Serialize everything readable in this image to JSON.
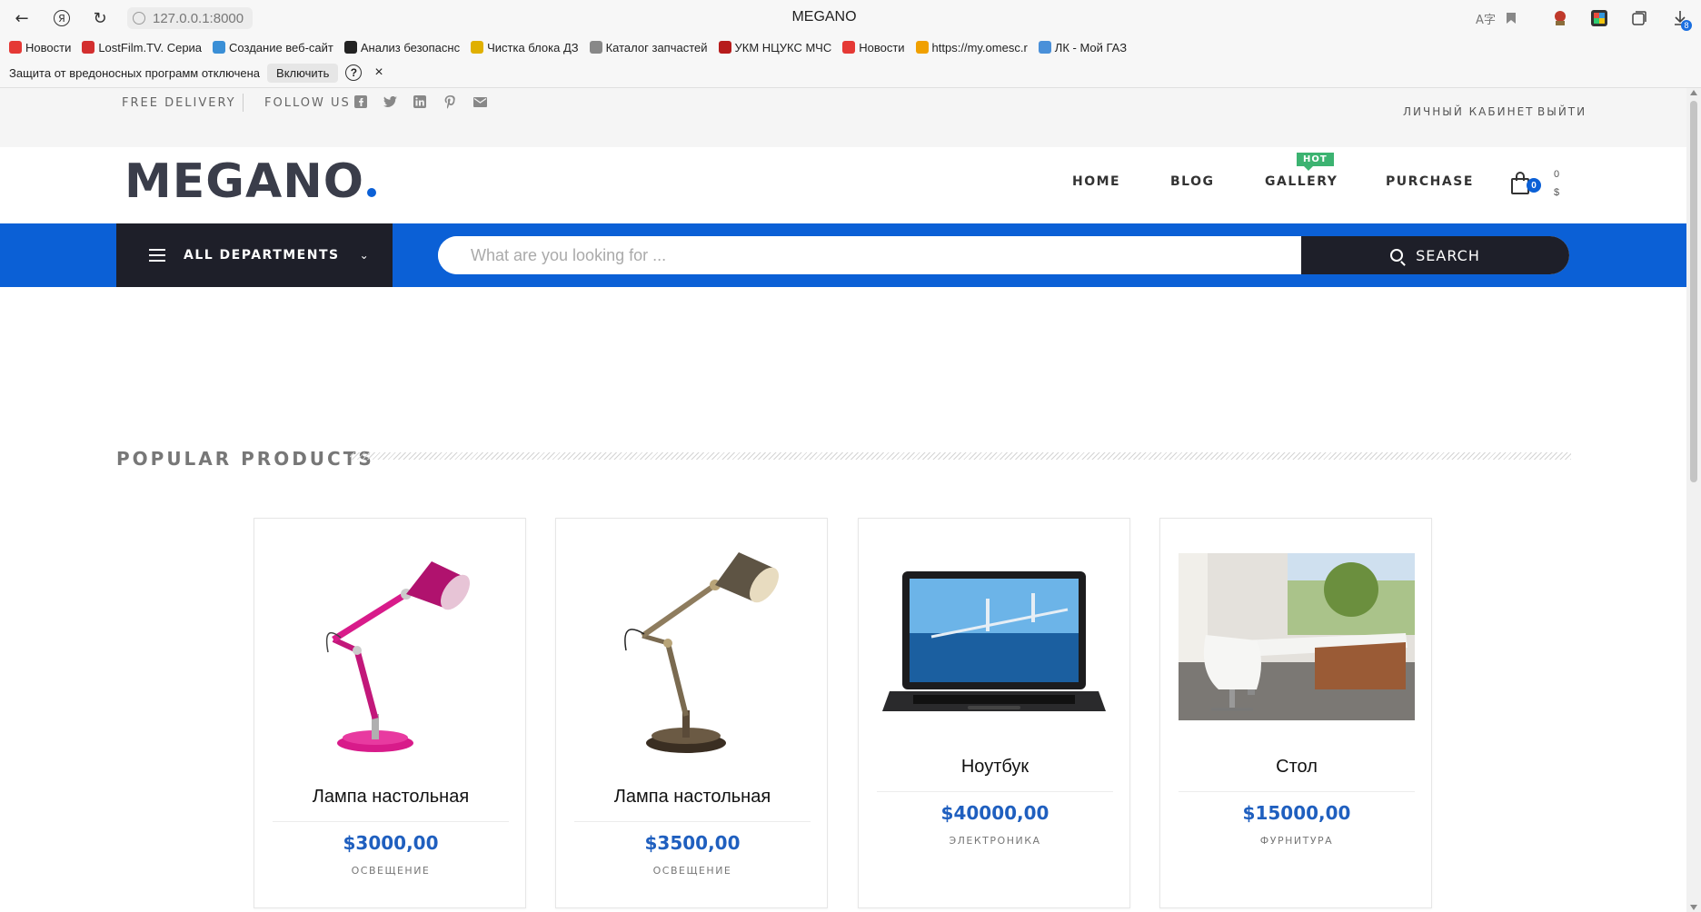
{
  "browser": {
    "url": "127.0.0.1:8000",
    "tab_title": "MEGANO",
    "download_count": "8",
    "bookmarks": [
      {
        "label": "Новости",
        "color": "#e53935"
      },
      {
        "label": "LostFilm.TV. Сериа",
        "color": "#d32f2f"
      },
      {
        "label": "Создание веб-сайт",
        "color": "#3a8fd6"
      },
      {
        "label": "Анализ безопаснс",
        "color": "#222222"
      },
      {
        "label": "Чистка блока ДЗ",
        "color": "#e0b000"
      },
      {
        "label": "Каталог запчастей",
        "color": "#888888"
      },
      {
        "label": "УКМ НЦУКС МЧС",
        "color": "#b71c1c"
      },
      {
        "label": "Новости",
        "color": "#e53935"
      },
      {
        "label": "https://my.omesc.r",
        "color": "#f0a000"
      },
      {
        "label": "ЛК - Мой ГАЗ",
        "color": "#4a90d9"
      }
    ],
    "infobar": {
      "message": "Защита от вредоносных программ отключена",
      "enable_label": "Включить",
      "help_label": "?",
      "close_label": "×"
    }
  },
  "topbar": {
    "free_delivery": "FREE DELIVERY",
    "follow_us": "FOLLOW US",
    "social_icons": [
      "facebook-icon",
      "twitter-icon",
      "linkedin-icon",
      "pinterest-icon",
      "mail-icon"
    ],
    "account_label": "ЛИЧНЫЙ КАБИНЕТ",
    "logout_label": "ВЫЙТИ"
  },
  "header": {
    "logo": "MEGANO",
    "menu": [
      "HOME",
      "BLOG",
      "GALLERY",
      "PURCHASE"
    ],
    "hot_badge": "HOT",
    "cart_count": "0",
    "cart_items": "0",
    "cart_total": "$"
  },
  "search": {
    "departments_label": "ALL DEPARTMENTS",
    "placeholder": "What are you looking for ...",
    "button_label": "SEARCH"
  },
  "popular": {
    "title": "POPULAR PRODUCTS",
    "products": [
      {
        "name": "Лампа настольная",
        "price": "$3000,00",
        "category": "ОСВЕЩЕНИЕ",
        "image": "pink-desk-lamp"
      },
      {
        "name": "Лампа настольная",
        "price": "$3500,00",
        "category": "ОСВЕЩЕНИЕ",
        "image": "bronze-desk-lamp"
      },
      {
        "name": "Ноутбук",
        "price": "$40000,00",
        "category": "ЭЛЕКТРОНИКА",
        "image": "laptop"
      },
      {
        "name": "Стол",
        "price": "$15000,00",
        "category": "ФУРНИТУРА",
        "image": "office-desk"
      }
    ]
  },
  "colors": {
    "brand_blue": "#0b60d6",
    "dark": "#1e1f29",
    "hot_green": "#3cb371",
    "price_blue": "#1f5fbf"
  }
}
